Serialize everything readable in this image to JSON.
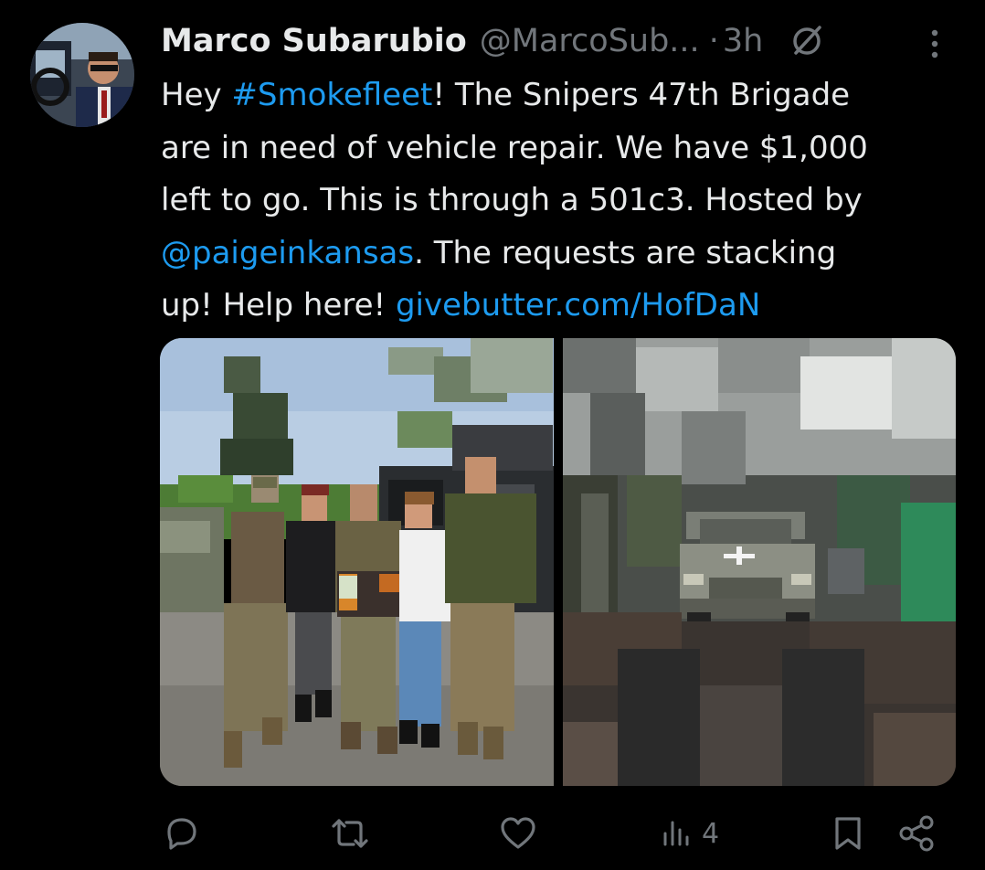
{
  "tweet": {
    "author": {
      "display_name": "Marco Subarubio",
      "handle": "@MarcoSub...",
      "avatar_icon": "profile-photo-man-driving"
    },
    "separator": "·",
    "time": "3h",
    "text": {
      "line1": {
        "before": "Hey ",
        "hashtag": "#Smokefleet",
        "after": "! The Snipers 47th Brigade"
      },
      "line2": "are in need of vehicle repair. We have $1,000",
      "line3": "left to go. This is through a 501c3. Hosted by",
      "line4": {
        "mention": "@paigeinkansas",
        "after": ". The requests are stacking"
      },
      "line5": {
        "before": "up! Help here! ",
        "link": "givebutter.com/HofDaN"
      }
    },
    "media": [
      {
        "description_icon": "photo-group-of-people-with-toolbox"
      },
      {
        "description_icon": "photo-damaged-suv-in-forest"
      }
    ],
    "actions": {
      "reply_icon": "reply-icon",
      "retweet_icon": "retweet-icon",
      "like_icon": "heart-icon",
      "views_icon": "views-bar-chart-icon",
      "views_count": "4",
      "bookmark_icon": "bookmark-icon",
      "share_icon": "share-icon"
    }
  },
  "colors": {
    "background": "#000000",
    "text": "#e7e9ea",
    "secondary": "#71767b",
    "link": "#1d9bf0"
  }
}
